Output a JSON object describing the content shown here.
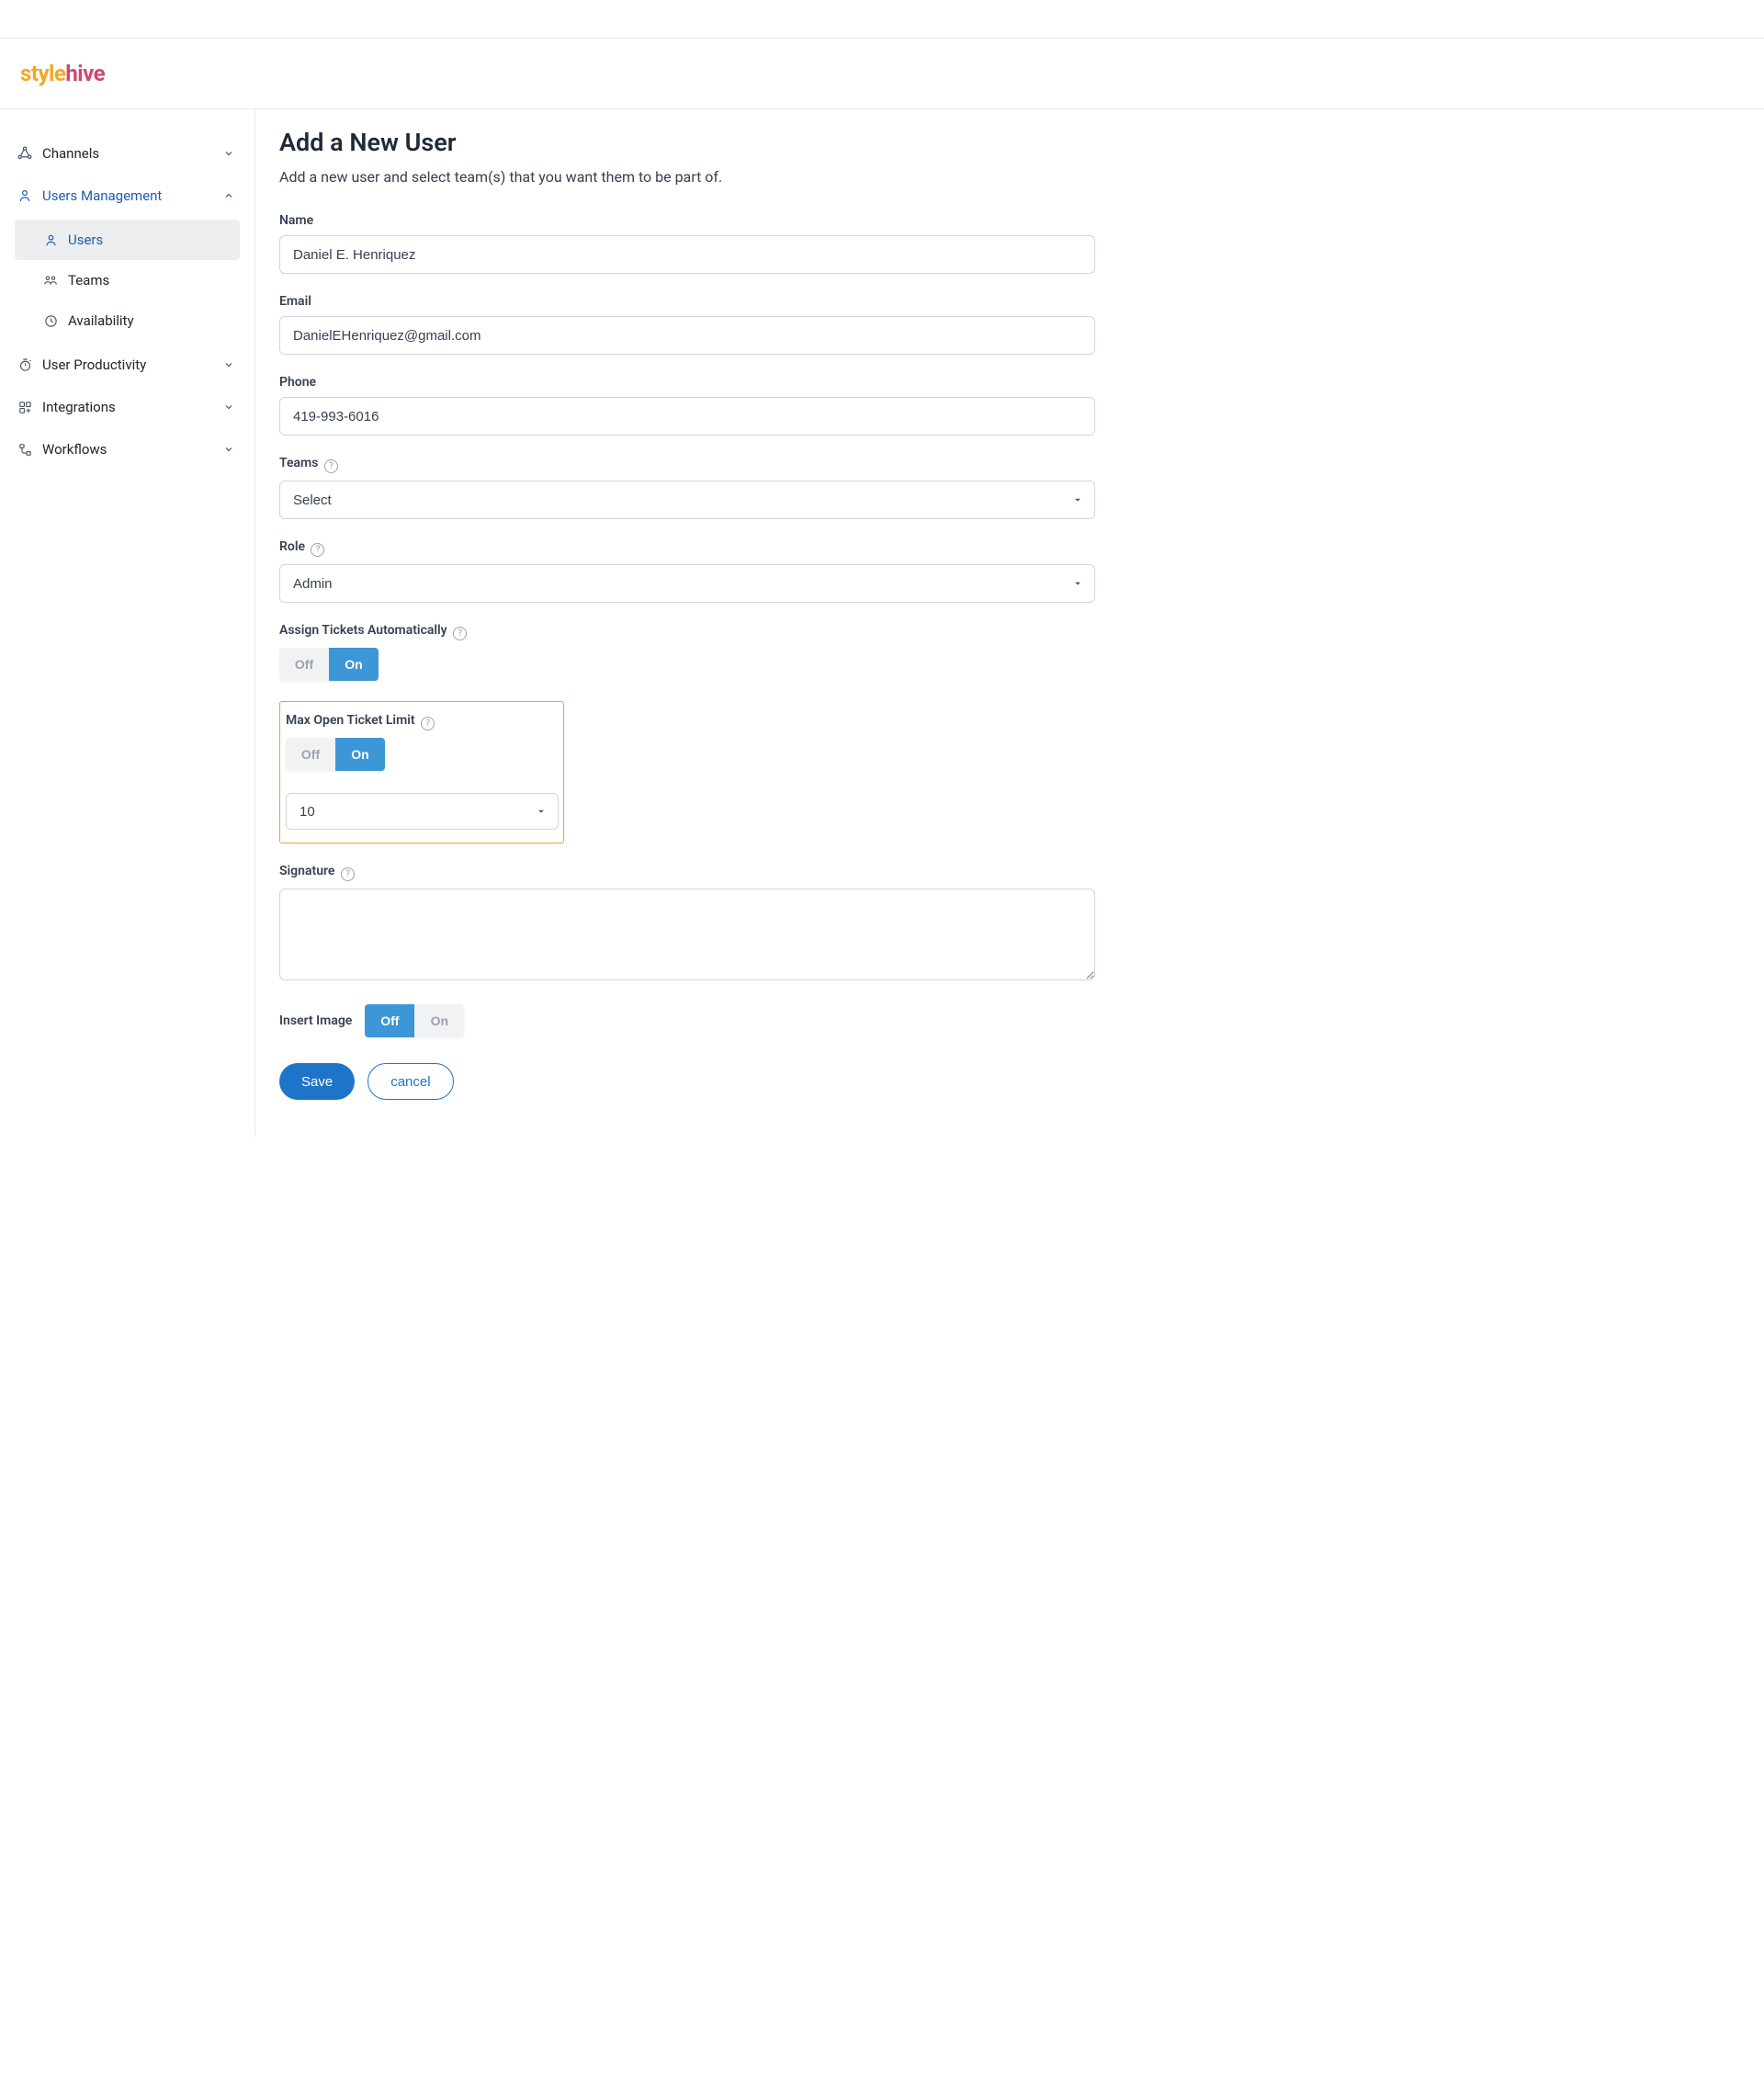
{
  "logo": {
    "part1": "style",
    "part2": "hive"
  },
  "sidebar": {
    "items": [
      {
        "label": "Channels"
      },
      {
        "label": "Users Management"
      },
      {
        "label": "User Productivity"
      },
      {
        "label": "Integrations"
      },
      {
        "label": "Workflows"
      }
    ],
    "usersSub": [
      {
        "label": "Users"
      },
      {
        "label": "Teams"
      },
      {
        "label": "Availability"
      }
    ]
  },
  "page": {
    "title": "Add a New User",
    "description": "Add a new user and select team(s) that you want them to be part of."
  },
  "form": {
    "name": {
      "label": "Name",
      "value": "Daniel E. Henriquez"
    },
    "email": {
      "label": "Email",
      "value": "DanielEHenriquez@gmail.com"
    },
    "phone": {
      "label": "Phone",
      "value": "419-993-6016"
    },
    "teams": {
      "label": "Teams",
      "value": "Select"
    },
    "role": {
      "label": "Role",
      "value": "Admin"
    },
    "assignAuto": {
      "label": "Assign Tickets Automatically",
      "off": "Off",
      "on": "On"
    },
    "maxOpen": {
      "label": "Max Open Ticket Limit",
      "off": "Off",
      "on": "On",
      "value": "10"
    },
    "signature": {
      "label": "Signature",
      "value": ""
    },
    "insertImage": {
      "label": "Insert Image",
      "off": "Off",
      "on": "On"
    }
  },
  "buttons": {
    "save": "Save",
    "cancel": "cancel"
  }
}
